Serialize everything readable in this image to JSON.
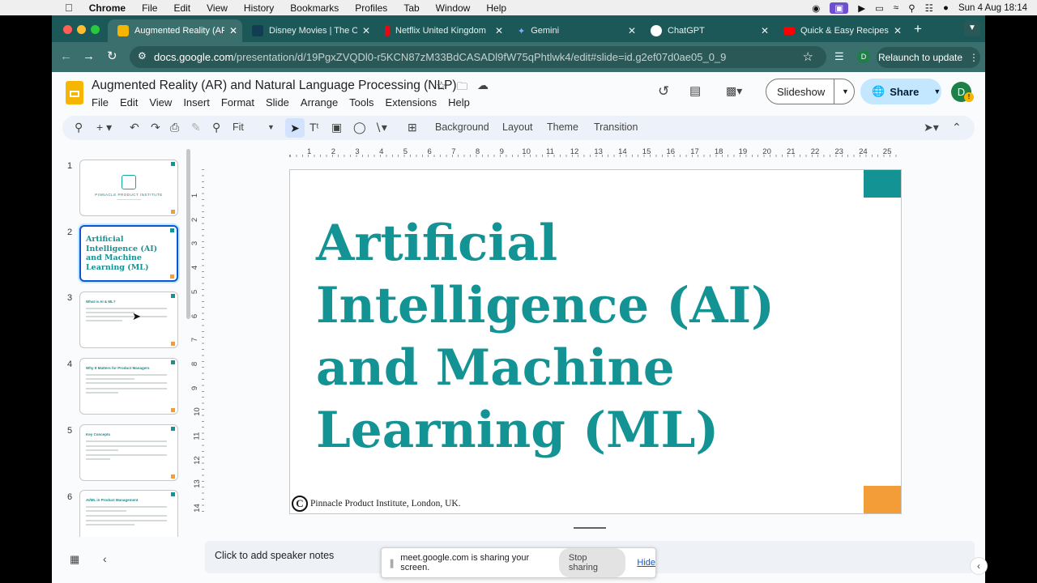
{
  "mac_menu": {
    "app": "Chrome",
    "items": [
      "File",
      "Edit",
      "View",
      "History",
      "Bookmarks",
      "Profiles",
      "Tab",
      "Window",
      "Help"
    ],
    "datetime": "Sun 4 Aug  18:14"
  },
  "tabs": [
    {
      "title": "Augmented Reality (AR)",
      "icon": "slides-icon",
      "color": "#f6b600",
      "active": true
    },
    {
      "title": "Disney Movies | The Offi",
      "icon": "disney-icon",
      "color": "#113c52"
    },
    {
      "title": "Netflix United Kingdom",
      "icon": "netflix-icon",
      "color": "#e50914"
    },
    {
      "title": "Gemini",
      "icon": "gemini-icon",
      "color": "#4a90e2"
    },
    {
      "title": "ChatGPT",
      "icon": "chatgpt-icon",
      "color": "#ffffff"
    },
    {
      "title": "Quick & Easy Recipes W",
      "icon": "youtube-icon",
      "color": "#ff0000"
    }
  ],
  "address": {
    "host": "docs.google.com",
    "path": "/presentation/d/19PgxZVQDl0-r5KCN87zM33BdCASADl9fW75qPhtlwk4/edit#slide=id.g2ef07d0ae05_0_9"
  },
  "relaunch_label": "Relaunch to update",
  "profile_initial": "D",
  "doc": {
    "title": "Augmented Reality (AR) and Natural Language Processing (NLP)",
    "menus": [
      "File",
      "Edit",
      "View",
      "Insert",
      "Format",
      "Slide",
      "Arrange",
      "Tools",
      "Extensions",
      "Help"
    ],
    "slideshow_label": "Slideshow",
    "share_label": "Share"
  },
  "toolbar": {
    "zoom": "Fit",
    "background": "Background",
    "layout": "Layout",
    "theme": "Theme",
    "transition": "Transition"
  },
  "ruler": {
    "h": [
      "1",
      "2",
      "3",
      "4",
      "5",
      "6",
      "7",
      "8",
      "9",
      "10",
      "11",
      "12",
      "13",
      "14",
      "15",
      "16",
      "17",
      "18",
      "19",
      "20",
      "21",
      "22",
      "23",
      "24",
      "25"
    ],
    "v": [
      "1",
      "2",
      "3",
      "4",
      "5",
      "6",
      "7",
      "8",
      "9",
      "10",
      "11",
      "12",
      "13",
      "14"
    ]
  },
  "thumbnails": [
    {
      "num": "1",
      "title": "PINNACLE PRODUCT INSTITUTE"
    },
    {
      "num": "2",
      "title": "Artificial Intelligence (AI) and Machine Learning (ML)"
    },
    {
      "num": "3",
      "title": "What is AI & ML?"
    },
    {
      "num": "4",
      "title": "Why It Matters for Product Managers"
    },
    {
      "num": "5",
      "title": "Key Concepts"
    },
    {
      "num": "6",
      "title": "AI/ML in Product Management"
    }
  ],
  "slide": {
    "title": "Artificial Intelligence (AI) and Machine Learning (ML)",
    "footer": "Pinnacle Product Institute, London, UK.",
    "copyright_symbol": "C"
  },
  "notes_placeholder": "Click to add speaker notes",
  "screen_share": {
    "message": "meet.google.com is sharing your screen.",
    "stop_label": "Stop sharing",
    "hide_label": "Hide"
  },
  "colors": {
    "accent_teal": "#149394",
    "accent_orange": "#f29d38",
    "browser_teal": "#1d5858"
  }
}
